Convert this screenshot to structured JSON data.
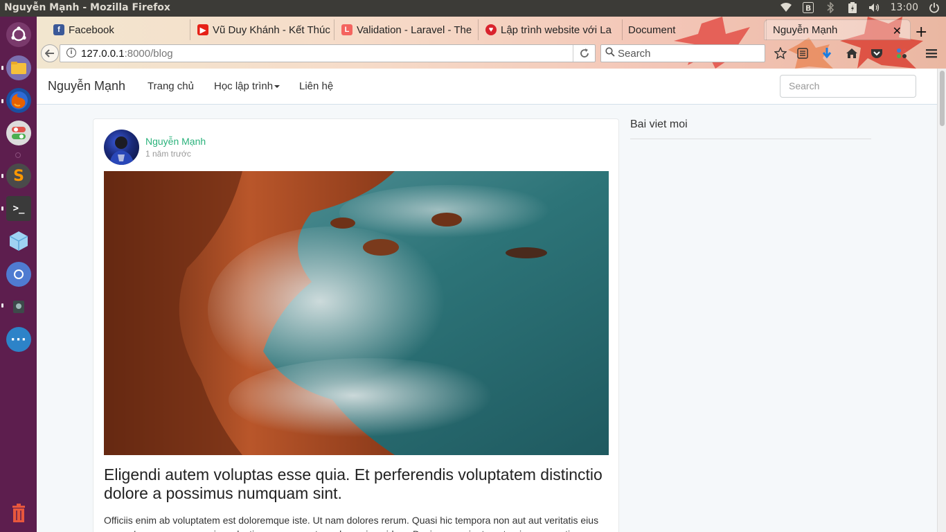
{
  "panel": {
    "window_title": "Nguyễn Mạnh - Mozilla Firefox",
    "clock": "13:00",
    "tray_icons": [
      "wifi-icon",
      "b-icon",
      "bluetooth-icon",
      "battery-icon",
      "volume-icon",
      "power-icon"
    ]
  },
  "launcher": {
    "items": [
      "ubuntu-logo-icon",
      "files-icon",
      "firefox-icon",
      "settings-toggle-icon",
      "sublime-icon",
      "terminal-icon",
      "virtualbox-icon",
      "chromium-icon",
      "app-icon",
      "more-apps-icon",
      "trash-icon"
    ]
  },
  "browser": {
    "tabs": [
      {
        "label": "Facebook",
        "icon": "facebook-icon"
      },
      {
        "label": "Vũ Duy Khánh - Kết Thúc",
        "icon": "youtube-icon"
      },
      {
        "label": "Validation - Laravel - The",
        "icon": "laravel-icon"
      },
      {
        "label": "Lập trình website với La",
        "icon": "red-icon"
      },
      {
        "label": "Document",
        "icon": ""
      },
      {
        "label": "Nguyễn Mạnh",
        "icon": "",
        "active": true
      }
    ],
    "url_host": "127.0.0.1",
    "url_rest": ":8000/blog",
    "search_placeholder": "Search"
  },
  "site": {
    "brand": "Nguyễn Mạnh",
    "menu": {
      "home": "Trang chủ",
      "learn": "Học lập trình",
      "contact": "Liên hệ"
    },
    "search_placeholder": "Search"
  },
  "post": {
    "author": "Nguyễn Mạnh",
    "time": "1 năm trước",
    "title": "Eligendi autem voluptas esse quia. Et perferendis voluptatem distinctio dolore a possimus numquam sint.",
    "excerpt": "Officiis enim ab voluptatem est doloremque iste. Ut nam dolores rerum. Quasi hic tempora non aut aut veritatis eius nemo. Ipsa magnam omnis molestiae consequuntur culpa quis quidem. Ducimus sapiente aut quis accusanti"
  },
  "sidebar": {
    "heading": "Bai viet moi"
  },
  "colors": {
    "launcher_bg": "#5d1e4e",
    "author_link": "#2ab27b",
    "panel_bg": "#3c3b37"
  }
}
